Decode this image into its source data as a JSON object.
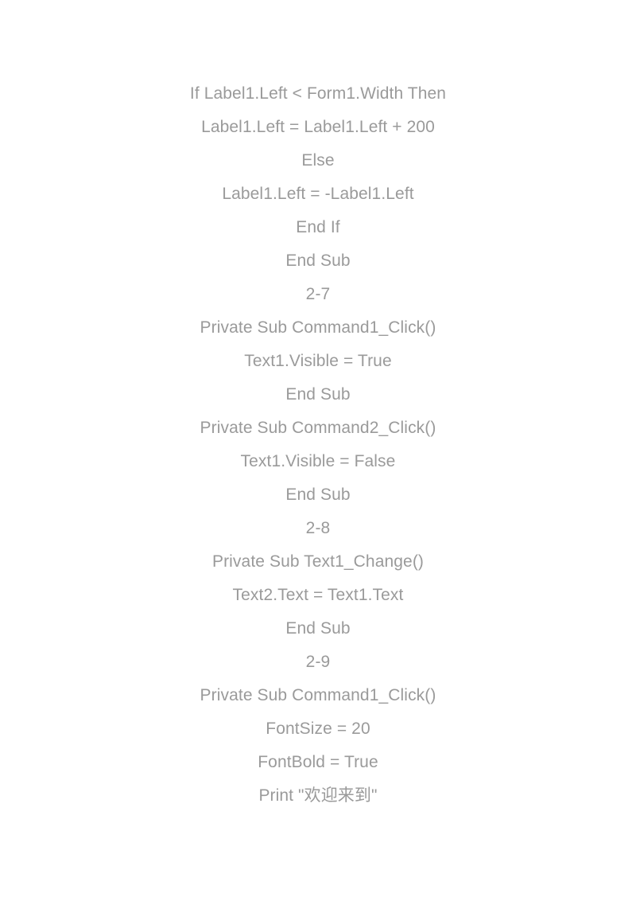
{
  "document": {
    "background_color": "#ffffff",
    "text_color": "#9a9a9a",
    "language": "Visual Basic source code listing",
    "lines": [
      {
        "id": "line-1",
        "text": "If Label1.Left < Form1.Width Then"
      },
      {
        "id": "line-2",
        "text": "Label1.Left = Label1.Left + 200"
      },
      {
        "id": "line-3",
        "text": "Else"
      },
      {
        "id": "line-4",
        "text": "Label1.Left = -Label1.Left"
      },
      {
        "id": "line-5",
        "text": "End If"
      },
      {
        "id": "line-6",
        "text": "End Sub"
      },
      {
        "id": "line-7",
        "text": "2-7"
      },
      {
        "id": "line-8",
        "text": "Private Sub Command1_Click()"
      },
      {
        "id": "line-9",
        "text": "Text1.Visible = True"
      },
      {
        "id": "line-10",
        "text": "End Sub"
      },
      {
        "id": "line-11",
        "text": "Private Sub Command2_Click()"
      },
      {
        "id": "line-12",
        "text": "Text1.Visible = False"
      },
      {
        "id": "line-13",
        "text": "End Sub"
      },
      {
        "id": "line-14",
        "text": "2-8"
      },
      {
        "id": "line-15",
        "text": "Private Sub Text1_Change()"
      },
      {
        "id": "line-16",
        "text": "Text2.Text = Text1.Text"
      },
      {
        "id": "line-17",
        "text": "End Sub"
      },
      {
        "id": "line-18",
        "text": "2-9"
      },
      {
        "id": "line-19",
        "text": "Private Sub Command1_Click()"
      },
      {
        "id": "line-20",
        "text": "FontSize = 20"
      },
      {
        "id": "line-21",
        "text": "FontBold = True"
      },
      {
        "id": "line-22",
        "text": "Print \"欢迎来到\""
      }
    ]
  }
}
